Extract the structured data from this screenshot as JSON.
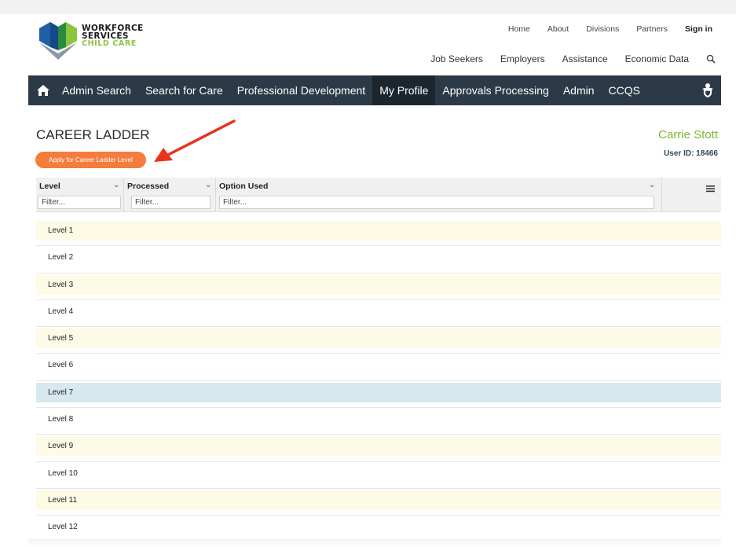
{
  "logo": {
    "line1": "WORKFORCE",
    "line2": "SERVICES",
    "line3": "CHILD CARE"
  },
  "util_nav": [
    {
      "label": "Home"
    },
    {
      "label": "About"
    },
    {
      "label": "Divisions"
    },
    {
      "label": "Partners"
    },
    {
      "label": "Sign in"
    }
  ],
  "main_links": [
    {
      "label": "Job Seekers"
    },
    {
      "label": "Employers"
    },
    {
      "label": "Assistance"
    },
    {
      "label": "Economic Data"
    }
  ],
  "navbar": {
    "items": [
      {
        "label": "Admin Search"
      },
      {
        "label": "Search for Care"
      },
      {
        "label": "Professional Development"
      },
      {
        "label": "My Profile",
        "active": true
      },
      {
        "label": "Approvals Processing"
      },
      {
        "label": "Admin"
      },
      {
        "label": "CCQS"
      }
    ]
  },
  "page": {
    "title": "CAREER LADDER",
    "apply_button": "Apply for Career Ladder Level",
    "user_name": "Carrie Stott",
    "user_id": "User ID: 18466"
  },
  "grid": {
    "columns": [
      {
        "title": "Level",
        "filter_placeholder": "Filter..."
      },
      {
        "title": "Processed",
        "filter_placeholder": "Filter..."
      },
      {
        "title": "Option Used",
        "filter_placeholder": "Filter..."
      }
    ],
    "rows": [
      {
        "label": "Level 1",
        "highlight": "#fdfbe6"
      },
      {
        "label": "Level 2",
        "highlight": "#ffffff"
      },
      {
        "label": "Level 3",
        "highlight": "#fdfbe6"
      },
      {
        "label": "Level 4",
        "highlight": "#ffffff"
      },
      {
        "label": "Level 5",
        "highlight": "#fdfbe6"
      },
      {
        "label": "Level 6",
        "highlight": "#ffffff"
      },
      {
        "label": "Level 7",
        "highlight": "#d7e9ef"
      },
      {
        "label": "Level 8",
        "highlight": "#ffffff"
      },
      {
        "label": "Level 9",
        "highlight": "#fdfbe6"
      },
      {
        "label": "Level 10",
        "highlight": "#ffffff"
      },
      {
        "label": "Level 11",
        "highlight": "#fdfbe6"
      },
      {
        "label": "Level 12",
        "highlight": "#ffffff"
      }
    ]
  },
  "colors": {
    "navbar": "#2b3a46",
    "accent_green": "#7ab733",
    "apply_orange": "#f47c3c",
    "arrow_red": "#e8341c"
  }
}
